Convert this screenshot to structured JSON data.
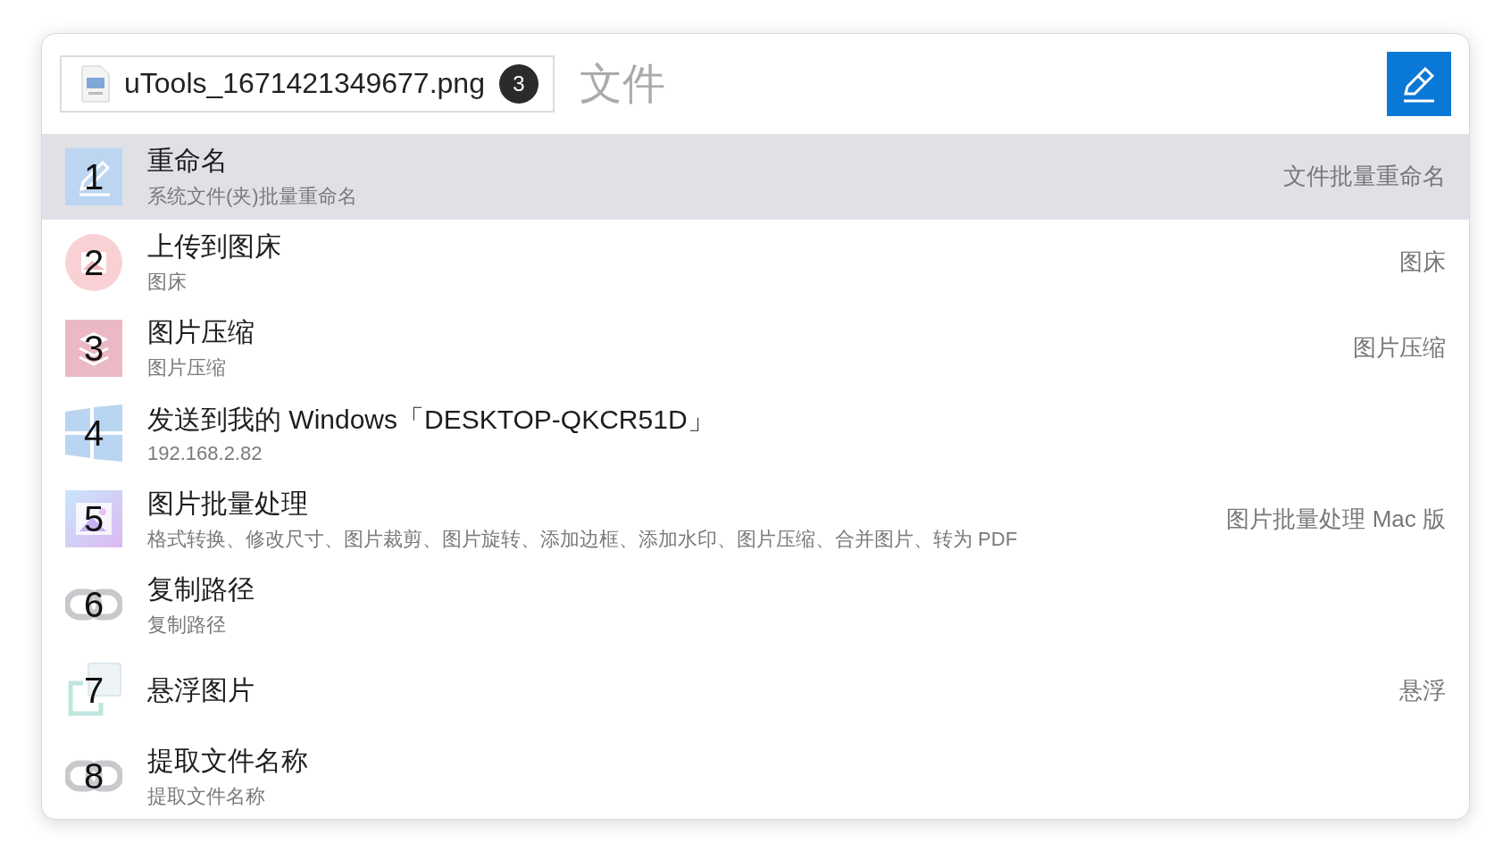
{
  "header": {
    "file": {
      "name": "uTools_1671421349677.png",
      "count": "3"
    },
    "search": {
      "placeholder": "文件"
    }
  },
  "results": [
    {
      "number": "1",
      "kind": "pencil",
      "title": "重命名",
      "subtitle": "系统文件(夹)批量重命名",
      "source": "文件批量重命名",
      "selected": true
    },
    {
      "number": "2",
      "kind": "upload",
      "title": "上传到图床",
      "subtitle": "图床",
      "source": "图床",
      "selected": false
    },
    {
      "number": "3",
      "kind": "layers",
      "title": "图片压缩",
      "subtitle": "图片压缩",
      "source": "图片压缩",
      "selected": false
    },
    {
      "number": "4",
      "kind": "windows",
      "title": "发送到我的 Windows「DESKTOP-QKCR51D」",
      "subtitle": "192.168.2.82",
      "selected": false
    },
    {
      "number": "5",
      "kind": "image",
      "title": "图片批量处理",
      "subtitle": "格式转换、修改尺寸、图片裁剪、图片旋转、添加边框、添加水印、图片压缩、合并图片、转为 PDF",
      "source": "图片批量处理 Mac 版",
      "selected": false
    },
    {
      "number": "6",
      "kind": "link",
      "title": "复制路径",
      "subtitle": "复制路径",
      "selected": false
    },
    {
      "number": "7",
      "kind": "float",
      "title": "悬浮图片",
      "source": "悬浮",
      "selected": false
    },
    {
      "number": "8",
      "kind": "link",
      "title": "提取文件名称",
      "subtitle": "提取文件名称",
      "selected": false
    }
  ]
}
